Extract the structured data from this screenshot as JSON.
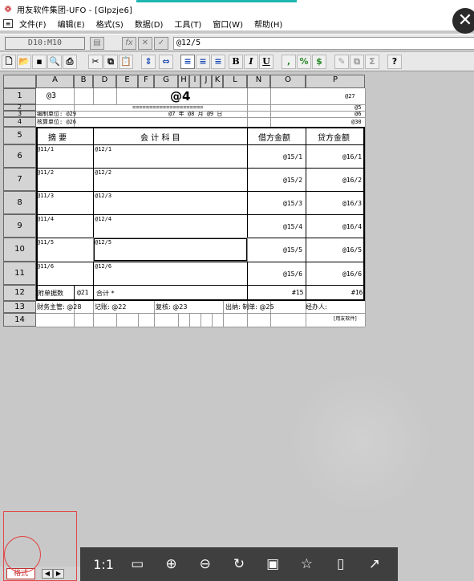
{
  "window": {
    "title": "用友软件集团-UFO - [Glpzje6]",
    "close_icon": "close-icon"
  },
  "menu": [
    "文件(F)",
    "编辑(E)",
    "格式(S)",
    "数据(D)",
    "工具(T)",
    "窗口(W)",
    "帮助(H)"
  ],
  "editbar": {
    "cell_ref": "D10:M10",
    "fx_label": "fx",
    "cancel_label": "✕",
    "confirm_label": "✓",
    "formula": "@12/5"
  },
  "toolbar": {
    "bold": "B",
    "italic": "I",
    "underline": "U",
    "comma": ",",
    "percent": "%",
    "currency": "$",
    "help": "?"
  },
  "columns": [
    "A",
    "B",
    "D",
    "E",
    "F",
    "G",
    "H",
    "I",
    "J",
    "K",
    "L",
    "N",
    "O",
    "P"
  ],
  "rows": [
    "1",
    "2",
    "3",
    "4",
    "5",
    "6",
    "7",
    "8",
    "9",
    "10",
    "11",
    "12",
    "13",
    "14"
  ],
  "sheet": {
    "r1_a": "@3",
    "r1_title": "@4",
    "r1_p": "@27",
    "r2_eq": "=====================",
    "r2_p": "@5",
    "r3_label": "编制单位: @29",
    "r3_date": "@7 年 @8 月 @9 日",
    "r3_p": "@6",
    "r4_label": "核算单位: @26",
    "r4_p": "@30",
    "h_summary": "摘    要",
    "h_subject": "会  计  科  目",
    "h_debit": "借方金额",
    "h_credit": "贷方金额",
    "data_rows": [
      {
        "a": "@11/1",
        "d": "@12/1",
        "debit": "@15/1",
        "credit": "@16/1"
      },
      {
        "a": "@11/2",
        "d": "@12/2",
        "debit": "@15/2",
        "credit": "@16/2"
      },
      {
        "a": "@11/3",
        "d": "@12/3",
        "debit": "@15/3",
        "credit": "@16/3"
      },
      {
        "a": "@11/4",
        "d": "@12/4",
        "debit": "@15/4",
        "credit": "@16/4"
      },
      {
        "a": "@11/5",
        "d": "@12/5",
        "debit": "@15/5",
        "credit": "@16/5"
      },
      {
        "a": "@11/6",
        "d": "@12/6",
        "debit": "@15/6",
        "credit": "@16/6"
      }
    ],
    "r12_a": "附单据数",
    "r12_b": "@21",
    "r12_d": "合计 *",
    "r12_debit": "#15",
    "r12_credit": "#16",
    "r13_a": "财务主管: @28",
    "r13_d": "记账: @22",
    "r13_g": "复核: @23",
    "r13_l": "出纳: 制单: @25",
    "r13_o": "经办人:",
    "r14_p": "[用友软件]"
  },
  "sheet_tab": "格式",
  "viewer": {
    "actual_size": "1:1"
  }
}
